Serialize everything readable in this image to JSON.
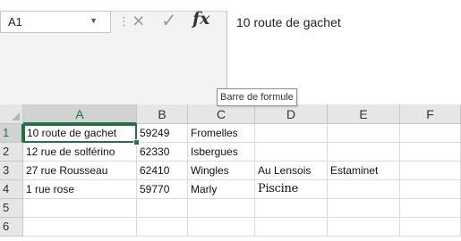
{
  "name_box": {
    "value": "A1",
    "dropdown_icon": "triangle-down",
    "separator_icon": "vertical-dots"
  },
  "formula_bar": {
    "cancel_icon": "×",
    "enter_icon": "✓",
    "fx_label": "fx",
    "value": "10 route de gachet",
    "tooltip": "Barre de formule"
  },
  "sheet": {
    "columns": [
      "A",
      "B",
      "C",
      "D",
      "E",
      "F"
    ],
    "active_column": "A",
    "active_row": "1",
    "selected_cell": "A1",
    "rows": [
      {
        "number": "1",
        "cells": [
          "10 route de gachet",
          "59249",
          "Fromelles",
          "",
          "",
          ""
        ]
      },
      {
        "number": "2",
        "cells": [
          "12 rue de solférino",
          "62330",
          "Isbergues",
          "",
          "",
          ""
        ]
      },
      {
        "number": "3",
        "cells": [
          "27 rue Rousseau",
          "62410",
          "Wingles",
          "Au Lensois",
          "Estaminet",
          ""
        ]
      },
      {
        "number": "4",
        "cells": [
          "1 rue rose",
          "59770",
          "Marly",
          "Piscine",
          "",
          ""
        ]
      },
      {
        "number": "5",
        "cells": [
          "",
          "",
          "",
          "",
          "",
          ""
        ]
      },
      {
        "number": "6",
        "cells": [
          "",
          "",
          "",
          "",
          "",
          ""
        ]
      }
    ]
  },
  "colors": {
    "accent": "#217346",
    "header_bg": "#e6e6e6",
    "gridline": "#dadada"
  }
}
